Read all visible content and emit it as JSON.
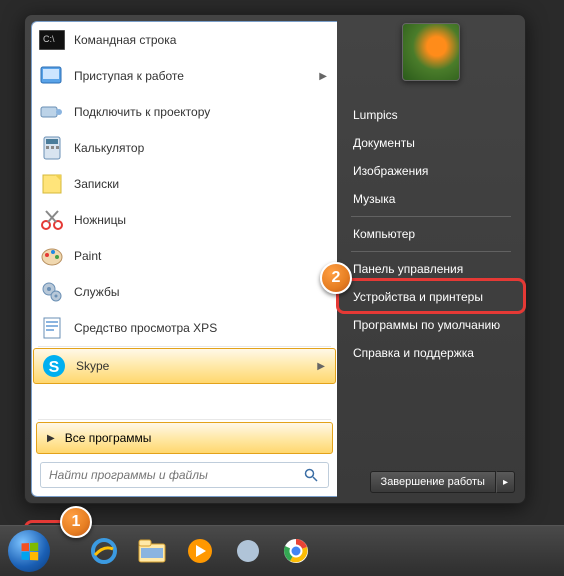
{
  "programs": [
    {
      "label": "Командная строка",
      "icon": "cmd"
    },
    {
      "label": "Приступая к работе",
      "icon": "getting-started",
      "arrow": true
    },
    {
      "label": "Подключить к проектору",
      "icon": "projector"
    },
    {
      "label": "Калькулятор",
      "icon": "calculator"
    },
    {
      "label": "Записки",
      "icon": "sticky-notes"
    },
    {
      "label": "Ножницы",
      "icon": "snipping"
    },
    {
      "label": "Paint",
      "icon": "paint"
    },
    {
      "label": "Службы",
      "icon": "services"
    },
    {
      "label": "Средство просмотра XPS",
      "icon": "xps"
    },
    {
      "label": "Skype",
      "icon": "skype",
      "highlighted": true,
      "arrow": true
    }
  ],
  "all_programs_label": "Все программы",
  "search": {
    "placeholder": "Найти программы и файлы"
  },
  "right_items": {
    "user": "Lumpics",
    "documents": "Документы",
    "pictures": "Изображения",
    "music": "Музыка",
    "computer": "Компьютер",
    "control_panel": "Панель управления",
    "devices": "Устройства и принтеры",
    "defaults": "Программы по умолчанию",
    "help": "Справка и поддержка"
  },
  "shutdown_label": "Завершение работы",
  "badges": {
    "one": "1",
    "two": "2"
  }
}
